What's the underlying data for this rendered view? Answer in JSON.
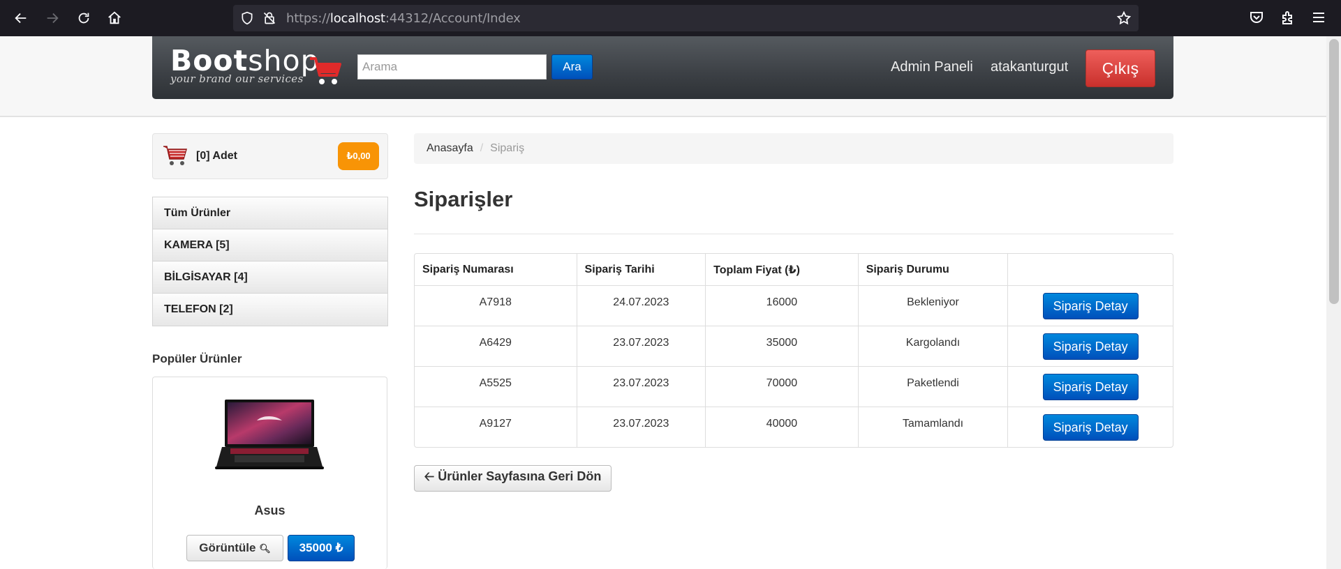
{
  "browser": {
    "url_scheme": "https://",
    "url_host": "localhost",
    "url_rest": ":44312/Account/Index"
  },
  "header": {
    "logo_bold": "Boot",
    "logo_thin": "shop",
    "logo_tagline": "your brand our services",
    "search_placeholder": "Arama",
    "search_button": "Ara",
    "admin_link": "Admin Paneli",
    "username": "atakanturgut",
    "logout_button": "Çıkış"
  },
  "sidebar": {
    "cart_count": "[0] Adet",
    "cart_total": "₺0,00",
    "categories": [
      {
        "label": "Tüm Ürünler"
      },
      {
        "label": "KAMERA [5]"
      },
      {
        "label": "BİLGİSAYAR [4]"
      },
      {
        "label": "TELEFON [2]"
      }
    ],
    "popular_title": "Popüler Ürünler",
    "product": {
      "name": "Asus",
      "view_button": "Görüntüle",
      "price_button": "35000 ₺"
    }
  },
  "main": {
    "breadcrumb": {
      "home": "Anasayfa",
      "separator": "/",
      "current": "Sipariş"
    },
    "title": "Siparişler",
    "table": {
      "headers": [
        "Sipariş Numarası",
        "Sipariş Tarihi",
        "Toplam Fiyat (₺)",
        "Sipariş Durumu",
        ""
      ],
      "rows": [
        {
          "number": "A7918",
          "date": "24.07.2023",
          "total": "16000",
          "status": "Bekleniyor",
          "action": "Sipariş Detay"
        },
        {
          "number": "A6429",
          "date": "23.07.2023",
          "total": "35000",
          "status": "Kargolandı",
          "action": "Sipariş Detay"
        },
        {
          "number": "A5525",
          "date": "23.07.2023",
          "total": "70000",
          "status": "Paketlendi",
          "action": "Sipariş Detay"
        },
        {
          "number": "A9127",
          "date": "23.07.2023",
          "total": "40000",
          "status": "Tamamlandı",
          "action": "Sipariş Detay"
        }
      ]
    },
    "back_button": "Ürünler Sayfasına Geri Dön"
  },
  "colors": {
    "primary": "#0068cc",
    "danger": "#d9534f",
    "warning": "#f89406",
    "navbar": "#3c4045"
  },
  "icons": [
    "back-arrow-icon",
    "forward-arrow-icon",
    "reload-icon",
    "home-icon",
    "shield-icon",
    "lock-icon",
    "star-icon",
    "pocket-icon",
    "extensions-icon",
    "menu-icon",
    "cart-icon",
    "search-icon",
    "arrow-left-icon"
  ]
}
